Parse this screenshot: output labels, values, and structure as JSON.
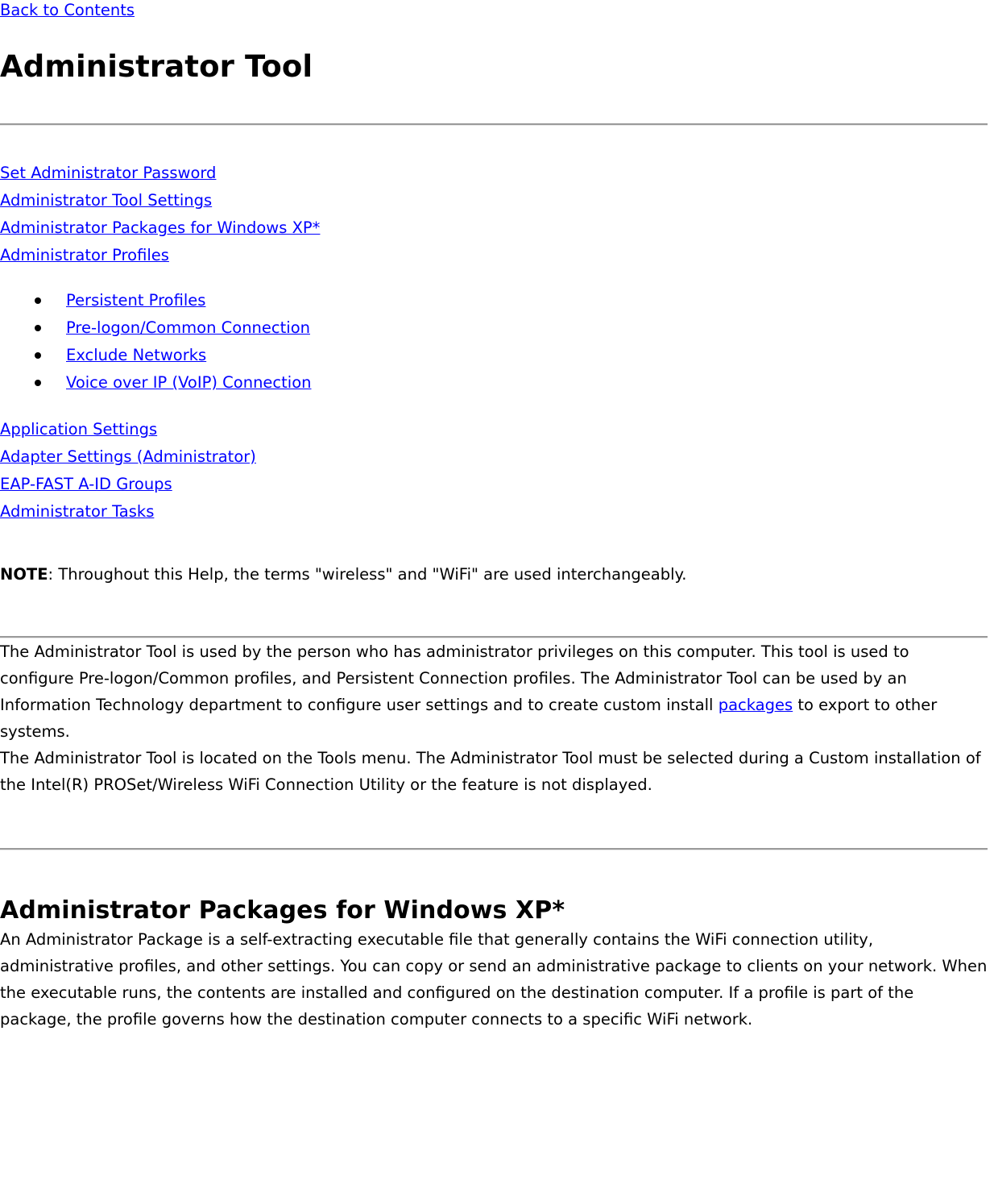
{
  "colors": {
    "link": "#0000FF",
    "text": "#000000",
    "background": "#FFFFFF",
    "rule": "#9A9A9A"
  },
  "header": {
    "back_link": "Back to Contents",
    "title": "Administrator Tool"
  },
  "toc": {
    "primary_links": [
      "Set Administrator Password",
      "Administrator Tool Settings",
      "Administrator Packages for Windows XP*",
      "Administrator Profiles"
    ],
    "profile_bullets": [
      "Persistent Profiles ",
      "Pre-logon/Common Connection",
      "Exclude Networks",
      "Voice over IP (VoIP) Connection"
    ],
    "secondary_links": [
      "Application Settings",
      "Adapter Settings (Administrator)",
      "EAP-FAST A-ID Groups",
      "Administrator Tasks"
    ]
  },
  "note": {
    "label": "NOTE",
    "separator": ": ",
    "text": "Throughout this Help, the terms \"wireless\" and \"WiFi\" are used interchangeably."
  },
  "body": {
    "paragraph_1_before_link": "The Administrator Tool is used by the person who has administrator privileges on this computer. This tool is used to configure Pre-logon/Common profiles, and Persistent Connection profiles. The Administrator Tool can be used by an Information Technology department to configure user settings and to create custom install ",
    "paragraph_1_link": "packages",
    "paragraph_1_after_link": " to export to other systems.",
    "paragraph_2": "The Administrator Tool is located on the Tools menu. The Administrator Tool must be selected during a Custom installation of the Intel(R) PROSet/Wireless WiFi Connection Utility or the feature is not displayed."
  },
  "section_packages": {
    "title": "Administrator Packages for Windows XP*",
    "paragraph": "An Administrator Package is a self-extracting executable file that generally contains the WiFi connection utility, administrative profiles, and other settings. You can copy or send an administrative package to clients on your network. When the executable runs, the contents are installed and configured on the destination computer. If a profile is part of the package, the profile governs how the destination computer connects to a specific WiFi network."
  }
}
